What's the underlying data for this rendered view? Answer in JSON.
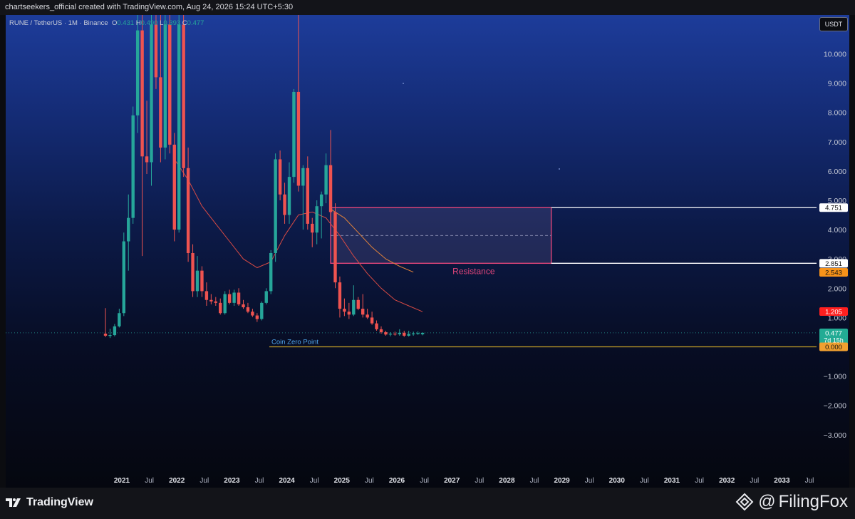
{
  "header": {
    "credit": "chartseekers_official created with TradingView.com, Aug 24, 2026 15:24 UTC+5:30"
  },
  "legend": {
    "symbol": "RUNE / TetherUS · 1M · Binance",
    "o_label": "O",
    "o_value": "0.431",
    "h_label": "H",
    "h_value": "0.490",
    "l_label": "L",
    "l_value": "0.393",
    "c_label": "C",
    "c_value": "0.477"
  },
  "currency": "USDT",
  "footer": {
    "brand": "TradingView",
    "watermark": "FilingFox",
    "at": "@"
  },
  "colors": {
    "up": "#26a69a",
    "down": "#ef5350",
    "resistance": "#e0457a",
    "zero_line": "#c9a227",
    "ma_orange": "#e0823a",
    "ma_red": "#d84a44",
    "accent_blue": "#2962ff"
  },
  "chart_data": {
    "type": "candlestick",
    "title": "",
    "ylim": [
      -3.5,
      11.0
    ],
    "y_ticks": [
      "10.000",
      "9.000",
      "8.000",
      "7.000",
      "6.000",
      "5.000",
      "4.000",
      "3.000",
      "2.000",
      "1.000",
      "−1.000",
      "−2.000",
      "−3.000"
    ],
    "y_tick_values": [
      10,
      9,
      8,
      7,
      6,
      5,
      4,
      3,
      2,
      1,
      -1,
      -2,
      -3
    ],
    "x_ticks": [
      {
        "t": "2021",
        "b": 1
      },
      {
        "t": "Jul",
        "b": 0
      },
      {
        "t": "2022",
        "b": 1
      },
      {
        "t": "Jul",
        "b": 0
      },
      {
        "t": "2023",
        "b": 1
      },
      {
        "t": "Jul",
        "b": 0
      },
      {
        "t": "2024",
        "b": 1
      },
      {
        "t": "Jul",
        "b": 0
      },
      {
        "t": "2025",
        "b": 1
      },
      {
        "t": "Jul",
        "b": 0
      },
      {
        "t": "2026",
        "b": 1
      },
      {
        "t": "Jul",
        "b": 0
      },
      {
        "t": "2027",
        "b": 1
      },
      {
        "t": "Jul",
        "b": 0
      },
      {
        "t": "2028",
        "b": 1
      },
      {
        "t": "Jul",
        "b": 0
      },
      {
        "t": "2029",
        "b": 1
      },
      {
        "t": "Jul",
        "b": 0
      },
      {
        "t": "2030",
        "b": 1
      },
      {
        "t": "Jul",
        "b": 0
      },
      {
        "t": "2031",
        "b": 1
      },
      {
        "t": "Jul",
        "b": 0
      },
      {
        "t": "2032",
        "b": 1
      },
      {
        "t": "Jul",
        "b": 0
      },
      {
        "t": "2033",
        "b": 1
      },
      {
        "t": "Jul",
        "b": 0
      }
    ],
    "x_start": "2020-09",
    "candles": [
      {
        "t": "2020-09",
        "o": 0.45,
        "h": 1.32,
        "l": 0.33,
        "c": 0.38
      },
      {
        "t": "2020-10",
        "o": 0.38,
        "h": 0.62,
        "l": 0.3,
        "c": 0.4
      },
      {
        "t": "2020-11",
        "o": 0.4,
        "h": 0.78,
        "l": 0.36,
        "c": 0.7
      },
      {
        "t": "2020-12",
        "o": 0.7,
        "h": 1.3,
        "l": 0.66,
        "c": 1.15
      },
      {
        "t": "2021-01",
        "o": 1.15,
        "h": 3.9,
        "l": 1.05,
        "c": 3.6
      },
      {
        "t": "2021-02",
        "o": 3.6,
        "h": 5.2,
        "l": 2.6,
        "c": 4.4
      },
      {
        "t": "2021-03",
        "o": 4.4,
        "h": 8.2,
        "l": 4.2,
        "c": 7.9
      },
      {
        "t": "2021-04",
        "o": 7.9,
        "h": 11.5,
        "l": 7.3,
        "c": 10.8
      },
      {
        "t": "2021-05",
        "o": 10.8,
        "h": 11.5,
        "l": 3.1,
        "c": 6.5
      },
      {
        "t": "2021-06",
        "o": 6.5,
        "h": 8.4,
        "l": 5.9,
        "c": 6.3
      },
      {
        "t": "2021-07",
        "o": 6.3,
        "h": 11.5,
        "l": 5.5,
        "c": 11.0
      },
      {
        "t": "2021-08",
        "o": 11.0,
        "h": 11.5,
        "l": 8.8,
        "c": 9.2
      },
      {
        "t": "2021-09",
        "o": 9.2,
        "h": 11.5,
        "l": 6.3,
        "c": 6.8
      },
      {
        "t": "2021-10",
        "o": 6.8,
        "h": 11.5,
        "l": 6.4,
        "c": 11.0
      },
      {
        "t": "2021-11",
        "o": 11.0,
        "h": 11.5,
        "l": 6.6,
        "c": 6.9
      },
      {
        "t": "2021-12",
        "o": 6.9,
        "h": 7.3,
        "l": 3.6,
        "c": 4.0
      },
      {
        "t": "2022-01",
        "o": 4.0,
        "h": 11.5,
        "l": 3.9,
        "c": 11.0
      },
      {
        "t": "2022-02",
        "o": 11.0,
        "h": 11.5,
        "l": 5.8,
        "c": 6.1
      },
      {
        "t": "2022-03",
        "o": 6.1,
        "h": 6.8,
        "l": 2.9,
        "c": 3.2
      },
      {
        "t": "2022-04",
        "o": 3.2,
        "h": 3.5,
        "l": 1.7,
        "c": 1.9
      },
      {
        "t": "2022-05",
        "o": 1.9,
        "h": 3.1,
        "l": 1.7,
        "c": 2.6
      },
      {
        "t": "2022-06",
        "o": 2.6,
        "h": 2.75,
        "l": 1.7,
        "c": 1.9
      },
      {
        "t": "2022-07",
        "o": 1.9,
        "h": 2.2,
        "l": 1.4,
        "c": 1.6
      },
      {
        "t": "2022-08",
        "o": 1.6,
        "h": 1.8,
        "l": 1.45,
        "c": 1.55
      },
      {
        "t": "2022-09",
        "o": 1.55,
        "h": 1.7,
        "l": 1.4,
        "c": 1.5
      },
      {
        "t": "2022-10",
        "o": 1.5,
        "h": 1.65,
        "l": 1.1,
        "c": 1.15
      },
      {
        "t": "2022-11",
        "o": 1.15,
        "h": 1.9,
        "l": 1.1,
        "c": 1.8
      },
      {
        "t": "2022-12",
        "o": 1.8,
        "h": 1.95,
        "l": 1.45,
        "c": 1.5
      },
      {
        "t": "2023-01",
        "o": 1.5,
        "h": 1.95,
        "l": 1.4,
        "c": 1.85
      },
      {
        "t": "2023-02",
        "o": 1.85,
        "h": 2.0,
        "l": 1.4,
        "c": 1.45
      },
      {
        "t": "2023-03",
        "o": 1.45,
        "h": 1.6,
        "l": 1.3,
        "c": 1.35
      },
      {
        "t": "2023-04",
        "o": 1.35,
        "h": 1.5,
        "l": 1.15,
        "c": 1.2
      },
      {
        "t": "2023-05",
        "o": 1.2,
        "h": 1.3,
        "l": 1.02,
        "c": 1.07
      },
      {
        "t": "2023-06",
        "o": 1.07,
        "h": 1.15,
        "l": 0.85,
        "c": 0.95
      },
      {
        "t": "2023-07",
        "o": 0.95,
        "h": 1.55,
        "l": 0.9,
        "c": 1.5
      },
      {
        "t": "2023-08",
        "o": 1.5,
        "h": 2.0,
        "l": 1.45,
        "c": 1.9
      },
      {
        "t": "2023-09",
        "o": 1.9,
        "h": 3.3,
        "l": 1.8,
        "c": 3.2
      },
      {
        "t": "2023-10",
        "o": 3.2,
        "h": 6.6,
        "l": 2.9,
        "c": 6.4
      },
      {
        "t": "2023-11",
        "o": 6.4,
        "h": 6.7,
        "l": 5.0,
        "c": 5.2
      },
      {
        "t": "2023-12",
        "o": 5.2,
        "h": 5.6,
        "l": 4.2,
        "c": 4.5
      },
      {
        "t": "2024-01",
        "o": 4.5,
        "h": 6.3,
        "l": 4.2,
        "c": 5.8
      },
      {
        "t": "2024-02",
        "o": 5.8,
        "h": 8.8,
        "l": 5.6,
        "c": 8.7
      },
      {
        "t": "2024-03",
        "o": 8.7,
        "h": 11.5,
        "l": 5.3,
        "c": 5.5
      },
      {
        "t": "2024-04",
        "o": 5.5,
        "h": 6.2,
        "l": 4.0,
        "c": 6.1
      },
      {
        "t": "2024-05",
        "o": 6.1,
        "h": 6.5,
        "l": 4.0,
        "c": 4.2
      },
      {
        "t": "2024-06",
        "o": 4.2,
        "h": 4.4,
        "l": 3.4,
        "c": 3.9
      },
      {
        "t": "2024-07",
        "o": 3.9,
        "h": 5.0,
        "l": 3.5,
        "c": 4.8
      },
      {
        "t": "2024-08",
        "o": 4.8,
        "h": 5.3,
        "l": 3.7,
        "c": 5.2
      },
      {
        "t": "2024-09",
        "o": 5.2,
        "h": 6.6,
        "l": 4.9,
        "c": 6.2
      },
      {
        "t": "2024-10",
        "o": 6.2,
        "h": 7.4,
        "l": 4.3,
        "c": 4.6
      },
      {
        "t": "2024-11",
        "o": 4.6,
        "h": 4.9,
        "l": 2.0,
        "c": 2.2
      },
      {
        "t": "2024-12",
        "o": 2.2,
        "h": 2.4,
        "l": 1.0,
        "c": 1.3
      },
      {
        "t": "2025-01",
        "o": 1.3,
        "h": 1.65,
        "l": 1.05,
        "c": 1.2
      },
      {
        "t": "2025-02",
        "o": 1.2,
        "h": 1.5,
        "l": 0.95,
        "c": 1.1
      },
      {
        "t": "2025-03",
        "o": 1.1,
        "h": 2.1,
        "l": 1.05,
        "c": 1.6
      },
      {
        "t": "2025-04",
        "o": 1.6,
        "h": 1.7,
        "l": 1.25,
        "c": 1.3
      },
      {
        "t": "2025-05",
        "o": 1.3,
        "h": 1.8,
        "l": 1.0,
        "c": 1.1
      },
      {
        "t": "2025-06",
        "o": 1.1,
        "h": 1.3,
        "l": 0.95,
        "c": 1.0
      },
      {
        "t": "2025-07",
        "o": 1.0,
        "h": 1.2,
        "l": 0.75,
        "c": 0.8
      },
      {
        "t": "2025-08",
        "o": 0.8,
        "h": 0.9,
        "l": 0.55,
        "c": 0.6
      },
      {
        "t": "2025-09",
        "o": 0.6,
        "h": 0.7,
        "l": 0.45,
        "c": 0.5
      },
      {
        "t": "2025-10",
        "o": 0.5,
        "h": 0.55,
        "l": 0.38,
        "c": 0.42
      },
      {
        "t": "2025-11",
        "o": 0.42,
        "h": 0.5,
        "l": 0.36,
        "c": 0.45
      },
      {
        "t": "2025-12",
        "o": 0.45,
        "h": 0.52,
        "l": 0.38,
        "c": 0.43
      },
      {
        "t": "2026-01",
        "o": 0.43,
        "h": 0.6,
        "l": 0.38,
        "c": 0.48
      },
      {
        "t": "2026-02",
        "o": 0.48,
        "h": 0.55,
        "l": 0.34,
        "c": 0.38
      },
      {
        "t": "2026-03",
        "o": 0.38,
        "h": 0.55,
        "l": 0.35,
        "c": 0.44
      },
      {
        "t": "2026-04",
        "o": 0.44,
        "h": 0.52,
        "l": 0.38,
        "c": 0.46
      },
      {
        "t": "2026-05",
        "o": 0.46,
        "h": 0.53,
        "l": 0.41,
        "c": 0.47
      },
      {
        "t": "2026-06",
        "o": 0.431,
        "h": 0.49,
        "l": 0.393,
        "c": 0.477
      }
    ],
    "ma_orange": [
      {
        "t": "2024-10",
        "v": 4.7
      },
      {
        "t": "2025-01",
        "v": 4.4
      },
      {
        "t": "2025-04",
        "v": 3.9
      },
      {
        "t": "2025-07",
        "v": 3.4
      },
      {
        "t": "2025-10",
        "v": 3.0
      },
      {
        "t": "2026-01",
        "v": 2.75
      },
      {
        "t": "2026-04",
        "v": 2.55
      }
    ],
    "ma_red": [
      {
        "t": "2021-12",
        "v": 6.4
      },
      {
        "t": "2022-03",
        "v": 5.7
      },
      {
        "t": "2022-06",
        "v": 4.8
      },
      {
        "t": "2022-09",
        "v": 4.2
      },
      {
        "t": "2022-12",
        "v": 3.6
      },
      {
        "t": "2023-03",
        "v": 3.0
      },
      {
        "t": "2023-06",
        "v": 2.7
      },
      {
        "t": "2023-09",
        "v": 2.9
      },
      {
        "t": "2023-12",
        "v": 3.8
      },
      {
        "t": "2024-03",
        "v": 4.5
      },
      {
        "t": "2024-06",
        "v": 4.6
      },
      {
        "t": "2024-09",
        "v": 4.4
      },
      {
        "t": "2024-12",
        "v": 3.8
      },
      {
        "t": "2025-03",
        "v": 3.1
      },
      {
        "t": "2025-06",
        "v": 2.5
      },
      {
        "t": "2025-09",
        "v": 2.0
      },
      {
        "t": "2025-12",
        "v": 1.6
      },
      {
        "t": "2026-03",
        "v": 1.4
      },
      {
        "t": "2026-06",
        "v": 1.2
      }
    ],
    "resistance_zone": {
      "label": "Resistance",
      "top": 4.751,
      "bottom": 2.851,
      "start": "2024-10",
      "end": "2028-10",
      "mid": 3.8
    },
    "horizontal_lines": [
      {
        "label": "Coin Zero Point",
        "value": 0.0
      }
    ],
    "price_labels": [
      {
        "text": "4.751",
        "value": 4.751,
        "bg": "#ffffff",
        "fg": "#111111"
      },
      {
        "text": "2.851",
        "value": 2.851,
        "bg": "#ffffff",
        "fg": "#111111"
      },
      {
        "text": "2.543",
        "value": 2.543,
        "bg": "#f7931a",
        "fg": "#111111"
      },
      {
        "text": "1.205",
        "value": 1.205,
        "bg": "#ff1f1f",
        "fg": "#ffffff"
      },
      {
        "text": "0.477",
        "value": 0.477,
        "bg": "#22ab94",
        "fg": "#ffffff",
        "sub": "7d 15h"
      },
      {
        "text": "0.000",
        "value": 0.0,
        "bg": "#f0a030",
        "fg": "#111111"
      }
    ]
  }
}
